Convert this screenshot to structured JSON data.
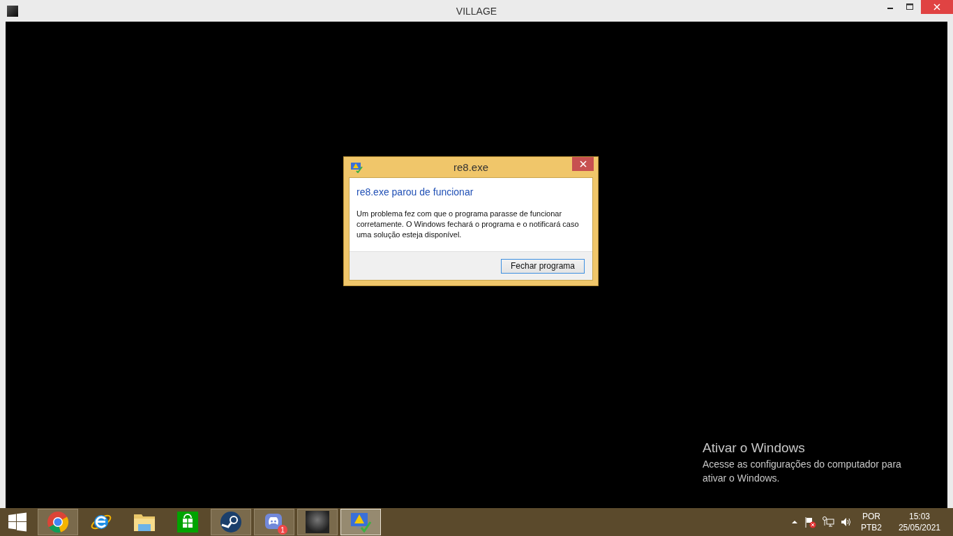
{
  "window": {
    "title": "VILLAGE"
  },
  "dialog": {
    "title": "re8.exe",
    "heading": "re8.exe parou de funcionar",
    "message": "Um problema fez com que o programa parasse de funcionar corretamente. O Windows fechará o programa e o notificará caso uma solução esteja disponível.",
    "button": "Fechar programa"
  },
  "activation": {
    "title": "Ativar o Windows",
    "text": "Acesse as configurações do computador para ativar o Windows."
  },
  "taskbar": {
    "items": [
      {
        "kind": "browser",
        "running": true,
        "selected": false
      },
      {
        "kind": "ie",
        "running": false,
        "selected": false
      },
      {
        "kind": "folder",
        "running": false,
        "selected": false
      },
      {
        "kind": "store",
        "running": false,
        "selected": false
      },
      {
        "kind": "steam",
        "running": true,
        "selected": false
      },
      {
        "kind": "chat",
        "running": true,
        "selected": false,
        "badge": "1"
      },
      {
        "kind": "game",
        "running": true,
        "selected": false
      },
      {
        "kind": "error",
        "running": true,
        "selected": true
      }
    ],
    "language": "POR",
    "layout": "PTB2",
    "time": "15:03",
    "date": "25/05/2021"
  }
}
